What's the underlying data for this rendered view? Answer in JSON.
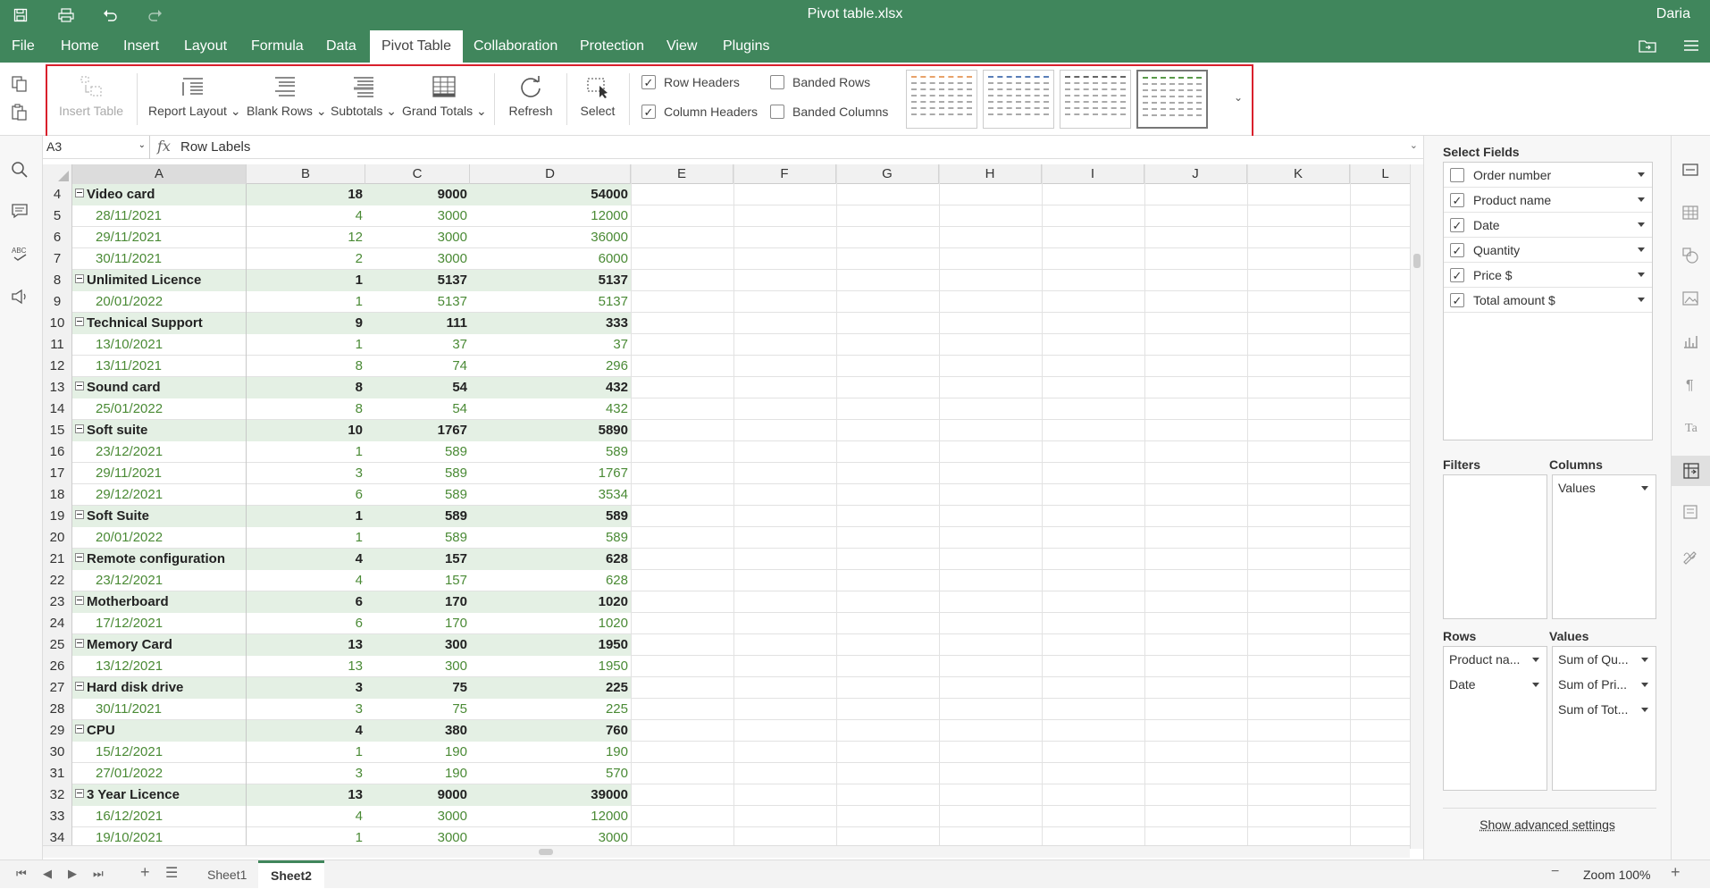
{
  "app": {
    "file_title": "Pivot table.xlsx",
    "user": "Daria"
  },
  "menu": {
    "tabs": [
      "File",
      "Home",
      "Insert",
      "Layout",
      "Formula",
      "Data",
      "Pivot Table",
      "Collaboration",
      "Protection",
      "View",
      "Plugins"
    ],
    "active": "Pivot Table"
  },
  "toolbar": {
    "insert_table": "Insert Table",
    "report_layout": "Report Layout",
    "blank_rows": "Blank Rows",
    "subtotals": "Subtotals",
    "grand_totals": "Grand Totals",
    "refresh": "Refresh",
    "select": "Select",
    "row_headers": "Row Headers",
    "column_headers": "Column Headers",
    "banded_rows": "Banded Rows",
    "banded_columns": "Banded Columns",
    "row_headers_checked": true,
    "column_headers_checked": true,
    "banded_rows_checked": false,
    "banded_columns_checked": false,
    "style_colors": [
      "#e8a26a",
      "#5a7fb8",
      "#666666",
      "#5a9a4a"
    ],
    "selected_style": 3
  },
  "formula_bar": {
    "cell_ref": "A3",
    "fx": "fx",
    "value": "Row Labels"
  },
  "grid": {
    "columns": [
      "A",
      "B",
      "C",
      "D",
      "E",
      "F",
      "G",
      "H",
      "I",
      "J",
      "K",
      "L"
    ],
    "selected_column": "A",
    "rows": [
      {
        "n": "4",
        "type": "group",
        "a": "Video card",
        "b": "18",
        "c": "9000",
        "d": "54000"
      },
      {
        "n": "5",
        "type": "detail",
        "a": "28/11/2021",
        "b": "4",
        "c": "3000",
        "d": "12000"
      },
      {
        "n": "6",
        "type": "detail",
        "a": "29/11/2021",
        "b": "12",
        "c": "3000",
        "d": "36000"
      },
      {
        "n": "7",
        "type": "detail",
        "a": "30/11/2021",
        "b": "2",
        "c": "3000",
        "d": "6000"
      },
      {
        "n": "8",
        "type": "group",
        "a": "Unlimited Licence",
        "b": "1",
        "c": "5137",
        "d": "5137"
      },
      {
        "n": "9",
        "type": "detail",
        "a": "20/01/2022",
        "b": "1",
        "c": "5137",
        "d": "5137"
      },
      {
        "n": "10",
        "type": "group",
        "a": "Technical Support",
        "b": "9",
        "c": "111",
        "d": "333"
      },
      {
        "n": "11",
        "type": "detail",
        "a": "13/10/2021",
        "b": "1",
        "c": "37",
        "d": "37"
      },
      {
        "n": "12",
        "type": "detail",
        "a": "13/11/2021",
        "b": "8",
        "c": "74",
        "d": "296"
      },
      {
        "n": "13",
        "type": "group",
        "a": "Sound card",
        "b": "8",
        "c": "54",
        "d": "432"
      },
      {
        "n": "14",
        "type": "detail",
        "a": "25/01/2022",
        "b": "8",
        "c": "54",
        "d": "432"
      },
      {
        "n": "15",
        "type": "group",
        "a": "Soft suite",
        "b": "10",
        "c": "1767",
        "d": "5890"
      },
      {
        "n": "16",
        "type": "detail",
        "a": "23/12/2021",
        "b": "1",
        "c": "589",
        "d": "589"
      },
      {
        "n": "17",
        "type": "detail",
        "a": "29/11/2021",
        "b": "3",
        "c": "589",
        "d": "1767"
      },
      {
        "n": "18",
        "type": "detail",
        "a": "29/12/2021",
        "b": "6",
        "c": "589",
        "d": "3534"
      },
      {
        "n": "19",
        "type": "group",
        "a": "Soft Suite",
        "b": "1",
        "c": "589",
        "d": "589"
      },
      {
        "n": "20",
        "type": "detail",
        "a": "20/01/2022",
        "b": "1",
        "c": "589",
        "d": "589"
      },
      {
        "n": "21",
        "type": "group",
        "a": "Remote configuration",
        "b": "4",
        "c": "157",
        "d": "628"
      },
      {
        "n": "22",
        "type": "detail",
        "a": "23/12/2021",
        "b": "4",
        "c": "157",
        "d": "628"
      },
      {
        "n": "23",
        "type": "group",
        "a": "Motherboard",
        "b": "6",
        "c": "170",
        "d": "1020"
      },
      {
        "n": "24",
        "type": "detail",
        "a": "17/12/2021",
        "b": "6",
        "c": "170",
        "d": "1020"
      },
      {
        "n": "25",
        "type": "group",
        "a": "Memory Card",
        "b": "13",
        "c": "300",
        "d": "1950"
      },
      {
        "n": "26",
        "type": "detail",
        "a": "13/12/2021",
        "b": "13",
        "c": "300",
        "d": "1950"
      },
      {
        "n": "27",
        "type": "group",
        "a": "Hard disk drive",
        "b": "3",
        "c": "75",
        "d": "225"
      },
      {
        "n": "28",
        "type": "detail",
        "a": "30/11/2021",
        "b": "3",
        "c": "75",
        "d": "225"
      },
      {
        "n": "29",
        "type": "group",
        "a": "CPU",
        "b": "4",
        "c": "380",
        "d": "760"
      },
      {
        "n": "30",
        "type": "detail",
        "a": "15/12/2021",
        "b": "1",
        "c": "190",
        "d": "190"
      },
      {
        "n": "31",
        "type": "detail",
        "a": "27/01/2022",
        "b": "3",
        "c": "190",
        "d": "570"
      },
      {
        "n": "32",
        "type": "group",
        "a": "3 Year Licence",
        "b": "13",
        "c": "9000",
        "d": "39000"
      },
      {
        "n": "33",
        "type": "detail",
        "a": "16/12/2021",
        "b": "4",
        "c": "3000",
        "d": "12000"
      },
      {
        "n": "34",
        "type": "detail",
        "a": "19/10/2021",
        "b": "1",
        "c": "3000",
        "d": "3000"
      }
    ]
  },
  "sheets": {
    "tabs": [
      "Sheet1",
      "Sheet2"
    ],
    "active": "Sheet2",
    "zoom": "Zoom 100%"
  },
  "panel": {
    "select_fields": "Select Fields",
    "fields": [
      {
        "label": "Order number",
        "checked": false
      },
      {
        "label": "Product name",
        "checked": true
      },
      {
        "label": "Date",
        "checked": true
      },
      {
        "label": "Quantity",
        "checked": true
      },
      {
        "label": "Price $",
        "checked": true
      },
      {
        "label": "Total amount $",
        "checked": true
      }
    ],
    "filters_label": "Filters",
    "columns_label": "Columns",
    "rows_label": "Rows",
    "values_label": "Values",
    "columns_items": [
      "Values"
    ],
    "rows_items": [
      "Product na...",
      "Date"
    ],
    "values_items": [
      "Sum of Qu...",
      "Sum of Pri...",
      "Sum of Tot..."
    ],
    "advanced": "Show advanced settings"
  }
}
